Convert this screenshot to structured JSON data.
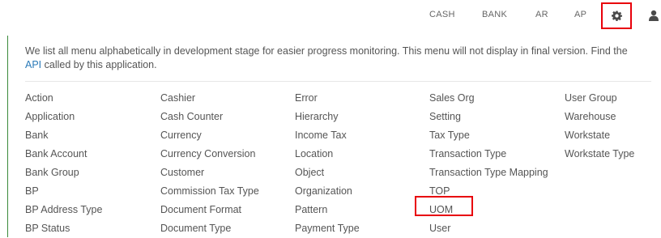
{
  "topnav": {
    "items": [
      "CASH",
      "BANK",
      "AR",
      "AP"
    ],
    "settings_icon": "gear-icon",
    "user_icon": "user-icon",
    "highlight_color": "#e8000b"
  },
  "intro": {
    "text_before": "We list all menu alphabetically in development stage for easier progress monitoring. This menu will not display in final version. Find the ",
    "link": "API",
    "text_after": " called by this application."
  },
  "menu": {
    "columns": [
      [
        "Action",
        "Application",
        "Bank",
        "Bank Account",
        "Bank Group",
        "BP",
        "BP Address Type",
        "BP Status"
      ],
      [
        "Cashier",
        "Cash Counter",
        "Currency",
        "Currency Conversion",
        "Customer",
        "Commission Tax Type",
        "Document Format",
        "Document Type"
      ],
      [
        "Error",
        "Hierarchy",
        "Income Tax",
        "Location",
        "Object",
        "Organization",
        "Pattern",
        "Payment Type"
      ],
      [
        "Sales Org",
        "Setting",
        "Tax Type",
        "Transaction Type",
        "Transaction Type Mapping",
        "TOP",
        "UOM",
        "User"
      ],
      [
        "User Group",
        "Warehouse",
        "Workstate",
        "Workstate Type"
      ]
    ],
    "highlighted_item": "UOM"
  }
}
